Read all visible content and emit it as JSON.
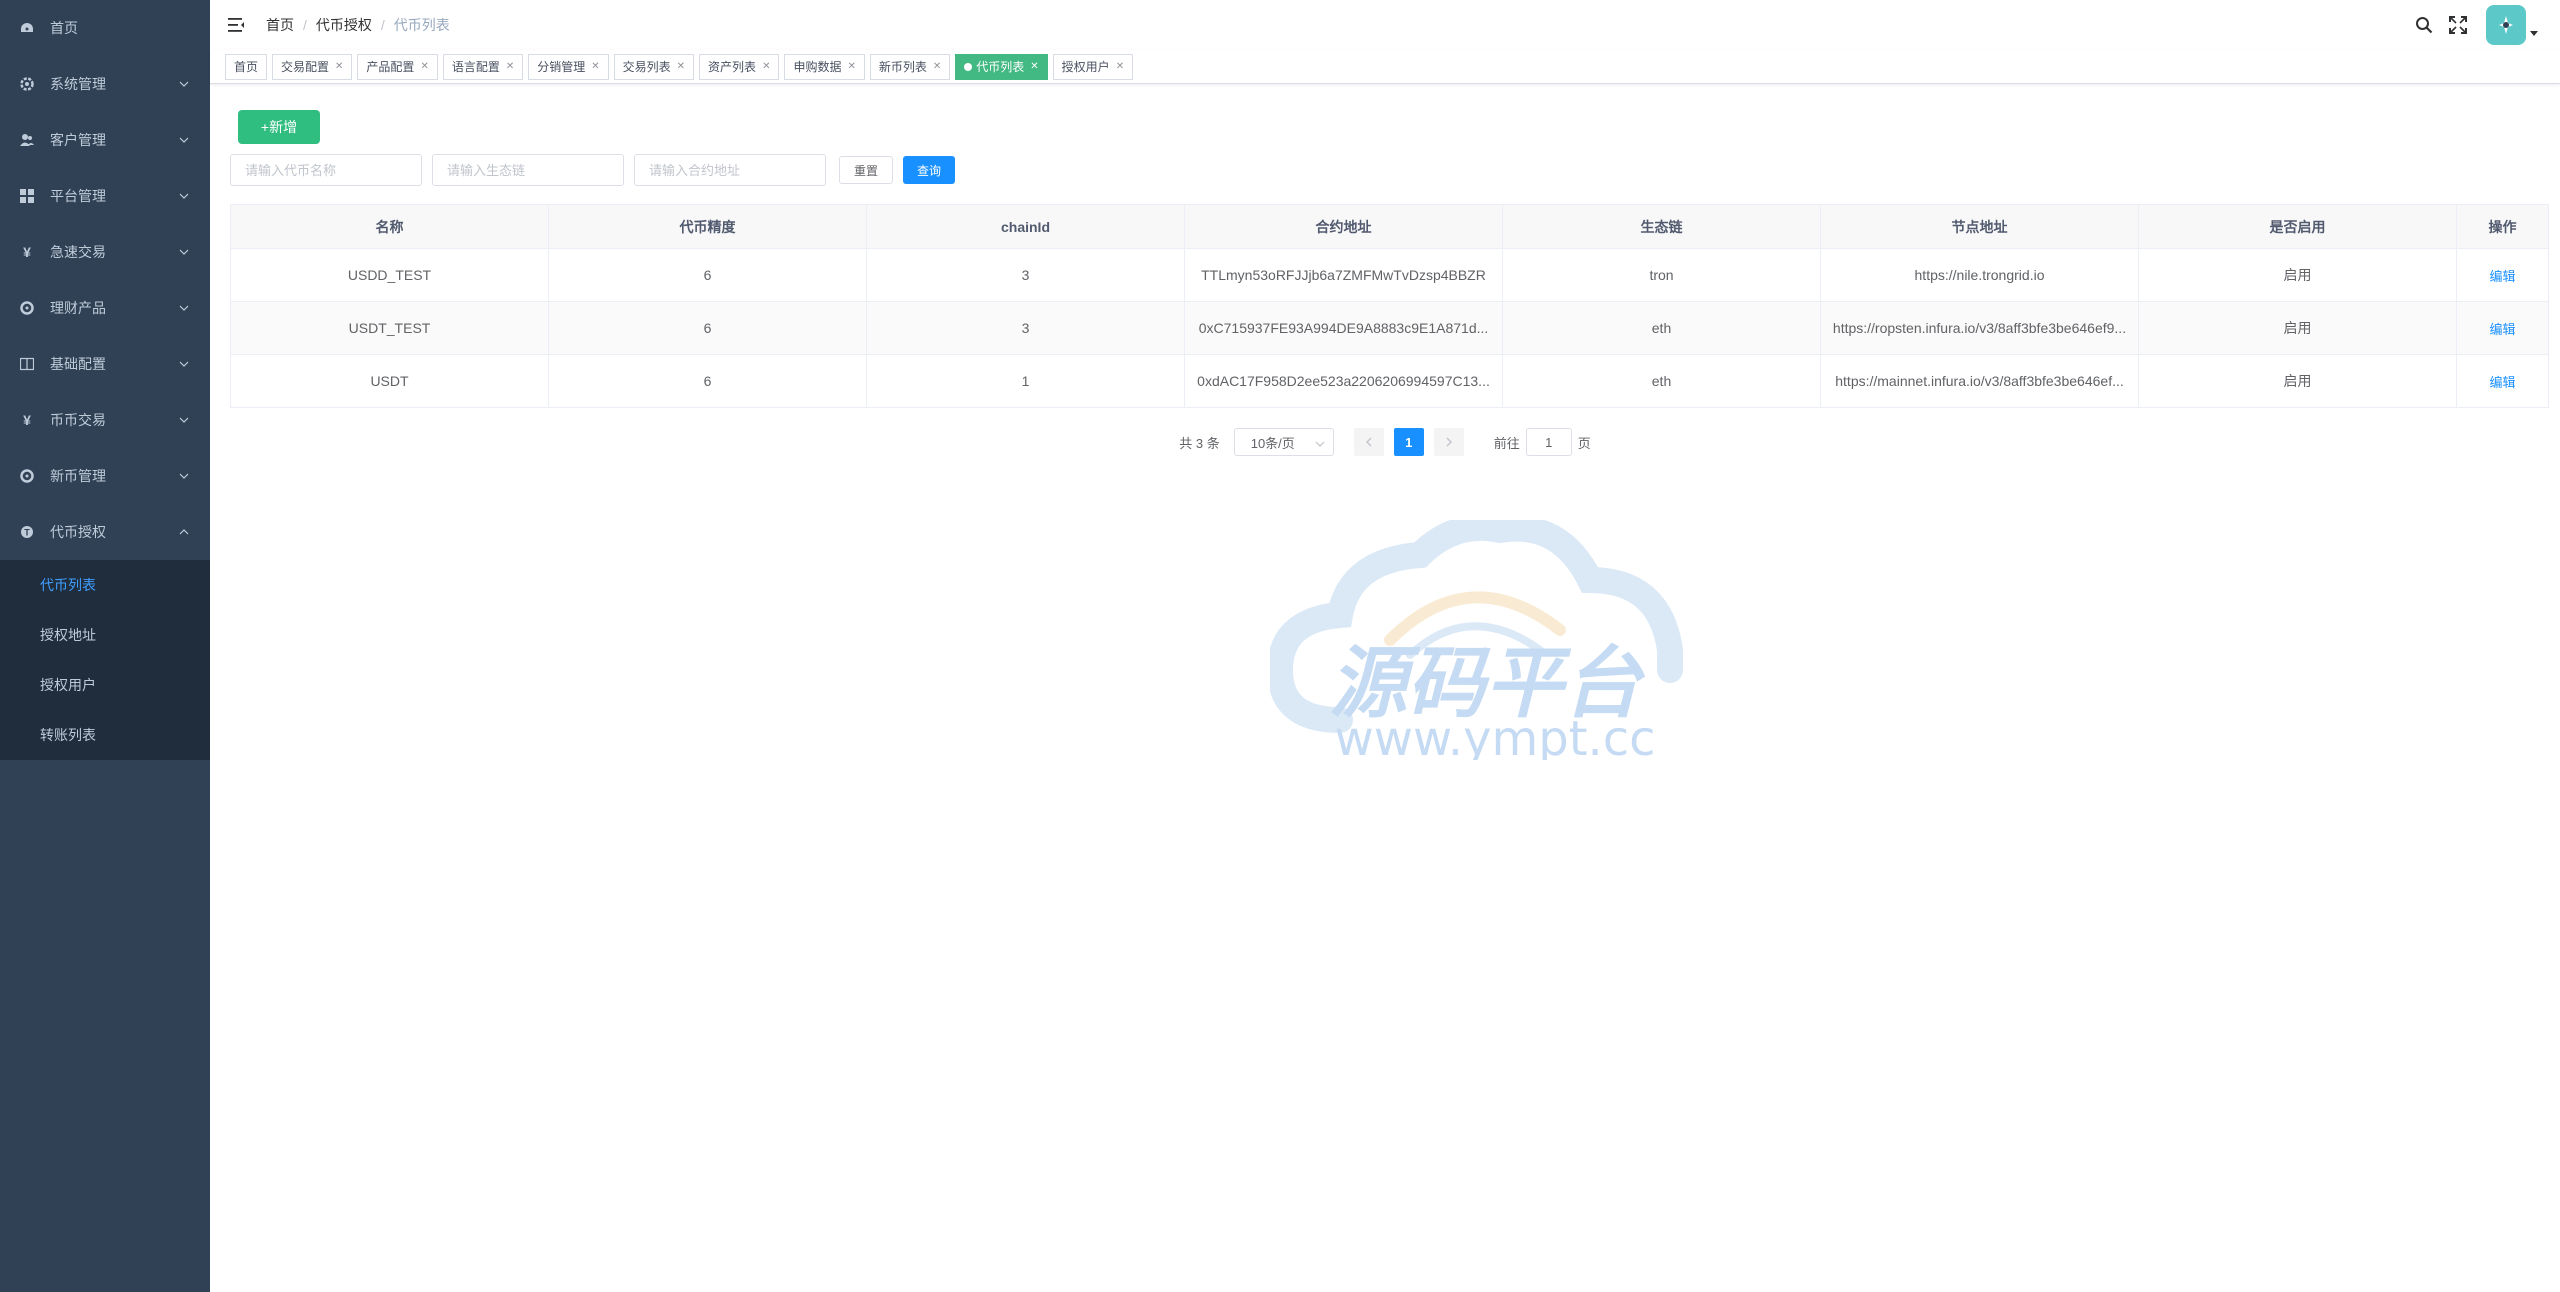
{
  "sidebar": {
    "items": [
      {
        "label": "首页",
        "icon": "dashboard-icon"
      },
      {
        "label": "系统管理",
        "icon": "gear-icon"
      },
      {
        "label": "客户管理",
        "icon": "users-icon"
      },
      {
        "label": "平台管理",
        "icon": "grid-icon"
      },
      {
        "label": "急速交易",
        "icon": "yen-icon"
      },
      {
        "label": "理财产品",
        "icon": "cog-icon"
      },
      {
        "label": "基础配置",
        "icon": "book-icon"
      },
      {
        "label": "币币交易",
        "icon": "yen-icon"
      },
      {
        "label": "新币管理",
        "icon": "cog-icon"
      },
      {
        "label": "代币授权",
        "icon": "token-icon"
      }
    ],
    "submenu": [
      {
        "label": "代币列表"
      },
      {
        "label": "授权地址"
      },
      {
        "label": "授权用户"
      },
      {
        "label": "转账列表"
      }
    ]
  },
  "breadcrumb": [
    "首页",
    "代币授权",
    "代币列表"
  ],
  "tags": [
    {
      "label": "首页"
    },
    {
      "label": "交易配置"
    },
    {
      "label": "产品配置"
    },
    {
      "label": "语言配置"
    },
    {
      "label": "分销管理"
    },
    {
      "label": "交易列表"
    },
    {
      "label": "资产列表"
    },
    {
      "label": "申购数据"
    },
    {
      "label": "新币列表"
    },
    {
      "label": "代币列表"
    },
    {
      "label": "授权用户"
    }
  ],
  "toolbar": {
    "add_label": "+新增",
    "reset_label": "重置",
    "search_label": "查询"
  },
  "filters": {
    "name_placeholder": "请输入代币名称",
    "chain_placeholder": "请输入生态链",
    "contract_placeholder": "请输入合约地址"
  },
  "table": {
    "headers": [
      "名称",
      "代币精度",
      "chainId",
      "合约地址",
      "生态链",
      "节点地址",
      "是否启用",
      "操作"
    ],
    "rows": [
      {
        "name": "USDD_TEST",
        "precision": "6",
        "chainId": "3",
        "contract": "TTLmyn53oRFJJjb6a7ZMFMwTvDzsp4BBZR",
        "chain": "tron",
        "node": "https://nile.trongrid.io",
        "enabled": "启用",
        "action": "编辑"
      },
      {
        "name": "USDT_TEST",
        "precision": "6",
        "chainId": "3",
        "contract": "0xC715937FE93A994DE9A8883c9E1A871d...",
        "chain": "eth",
        "node": "https://ropsten.infura.io/v3/8aff3bfe3be646ef9...",
        "enabled": "启用",
        "action": "编辑"
      },
      {
        "name": "USDT",
        "precision": "6",
        "chainId": "1",
        "contract": "0xdAC17F958D2ee523a2206206994597C13...",
        "chain": "eth",
        "node": "https://mainnet.infura.io/v3/8aff3bfe3be646ef...",
        "enabled": "启用",
        "action": "编辑"
      }
    ]
  },
  "pagination": {
    "total": "共 3 条",
    "page_size": "10条/页",
    "current": "1",
    "goto_prefix": "前往",
    "goto_value": "1",
    "goto_suffix": "页"
  },
  "watermark": {
    "title": "源码平台",
    "url": "www.ympt.cc"
  },
  "colors": {
    "sidebar_bg": "#304156",
    "submenu_bg": "#1f2d3d",
    "active_link": "#409eff",
    "active_tag": "#42b983",
    "primary": "#1890ff"
  }
}
